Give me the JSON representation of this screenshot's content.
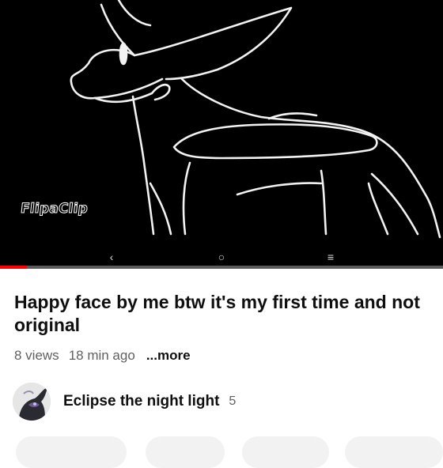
{
  "video": {
    "watermark": "FlipaClip",
    "progress_fraction": 0.06,
    "nav": {
      "back_glyph": "‹",
      "home_glyph": "○",
      "menu_glyph": "≡"
    }
  },
  "info": {
    "title": "Happy face by me btw it's my first time and not original",
    "views": "8 views",
    "age": "18 min ago",
    "more_label": "...more"
  },
  "channel": {
    "name": "Eclipse the night light",
    "subscriber_count": "5"
  },
  "colors": {
    "progress": "#ff0000",
    "progress_track": "#5a5a5a",
    "title": "#0f0f0f",
    "meta": "#606060",
    "video_bg": "#000000"
  }
}
